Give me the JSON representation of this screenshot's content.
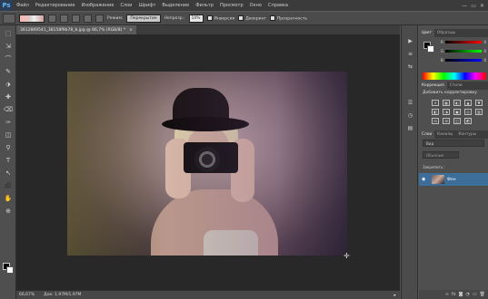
{
  "menu": {
    "logo": "Ps",
    "items": [
      "Файл",
      "Редактирование",
      "Изображение",
      "Слои",
      "Шрифт",
      "Выделение",
      "Фильтр",
      "Просмотр",
      "Окно",
      "Справка"
    ],
    "window_controls": [
      "—",
      "▭",
      "✕"
    ]
  },
  "options": {
    "mode_label": "Режим:",
    "mode_value": "Перекрытие",
    "opacity_label": "Непрозр.:",
    "opacity_value": "10%",
    "inverse_label": "Инверсия",
    "dither_label": "Дизеринг",
    "transparency_label": "Прозрачность"
  },
  "document": {
    "tab_title": "3812869541_38158f9b78_b.jpg @ 66,7% (RGB/8) *",
    "close": "×"
  },
  "status": {
    "zoom": "66,67%",
    "doc_info": "Док: 1,97M/1,97M",
    "arrow": "▸"
  },
  "panels": {
    "color_tab": "Цвет",
    "swatches_tab": "Образцы",
    "sliders": [
      {
        "label": "R",
        "value": "0",
        "color": "#c44"
      },
      {
        "label": "G",
        "value": "0",
        "color": "#4a4"
      },
      {
        "label": "B",
        "value": "0",
        "color": "#44c"
      }
    ],
    "correction_tab": "Коррекция",
    "styles_tab": "Стили",
    "add_correction": "Добавить корректировку",
    "adj_icons": [
      "☀",
      "▦",
      "◐",
      "▲",
      "▼",
      "◧",
      "◑",
      "▣",
      "◎",
      "▥",
      "⊟",
      "⊞",
      "◫",
      "◩"
    ],
    "layers_tab": "Слои",
    "channels_tab": "Каналы",
    "contours_tab": "Контуры",
    "kind_value": "Вид",
    "mode_value": "Обычные",
    "lock_label": "Закрепить:",
    "layer_name": "Фон",
    "bottom_icons": [
      "∞",
      "fx",
      "◙",
      "◔",
      "▭",
      "🗑"
    ]
  },
  "tools": [
    "⬚",
    "⇲",
    "⌒",
    "✎",
    "⬗",
    "✚",
    "⌫",
    "✑",
    "◫",
    "⚲",
    "T",
    "↖",
    "⬛",
    "✋",
    "⊕"
  ],
  "strip": [
    "▶",
    "≡",
    "⇆",
    "☰",
    "◷",
    "▤"
  ]
}
